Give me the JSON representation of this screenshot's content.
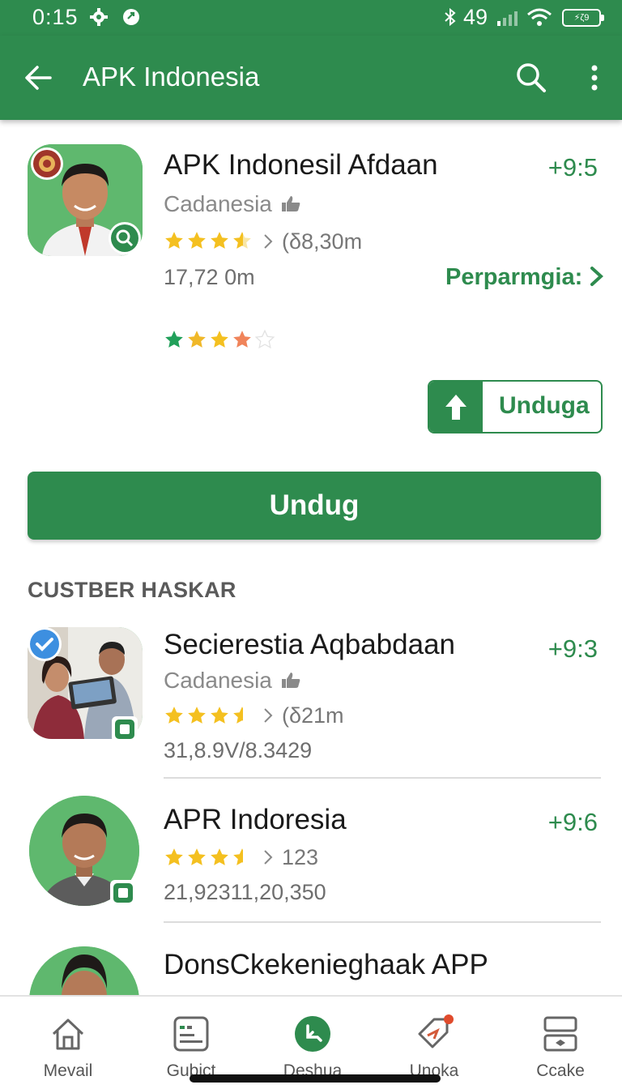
{
  "status_bar": {
    "time": "0:15",
    "battery_text": "49",
    "battery_label": "⚡ζ9"
  },
  "app_bar": {
    "title": "APK Indonesia"
  },
  "main_app": {
    "name": "APK Indonesil Afdaan",
    "developer": "Cadanesia",
    "rating_meta": "(δ8,30m",
    "size": "17,72 0m",
    "score": "+9:5",
    "permission_link": "Perparmgia:",
    "user_rating": 3.5,
    "small_download_label": "Unduga",
    "download_button": "Undug"
  },
  "section": {
    "title": "CUSTBER HASKAR"
  },
  "list_items": [
    {
      "name": "Secierestia Aqbabdaan",
      "developer": "Cadanesia",
      "rating_meta": "(δ21m",
      "size": "31,8.9V/8.3429",
      "score": "+9:3"
    },
    {
      "name": "APR Indoresia",
      "developer": "",
      "rating_meta": "123",
      "size": "21,92311,20,350",
      "score": "+9:6"
    },
    {
      "name": "DonsCkekenieghaak APP",
      "developer": "",
      "rating_meta": "",
      "size": "",
      "score": ""
    }
  ],
  "bottom_nav": [
    {
      "label": "Mevail",
      "icon": "home-icon"
    },
    {
      "label": "Gubict",
      "icon": "document-icon"
    },
    {
      "label": "Deshua",
      "icon": "download-icon"
    },
    {
      "label": "Unoka",
      "icon": "tag-icon"
    },
    {
      "label": "Ccake",
      "icon": "device-icon"
    }
  ],
  "colors": {
    "primary": "#2e8b4e",
    "star": "#f4c020"
  }
}
